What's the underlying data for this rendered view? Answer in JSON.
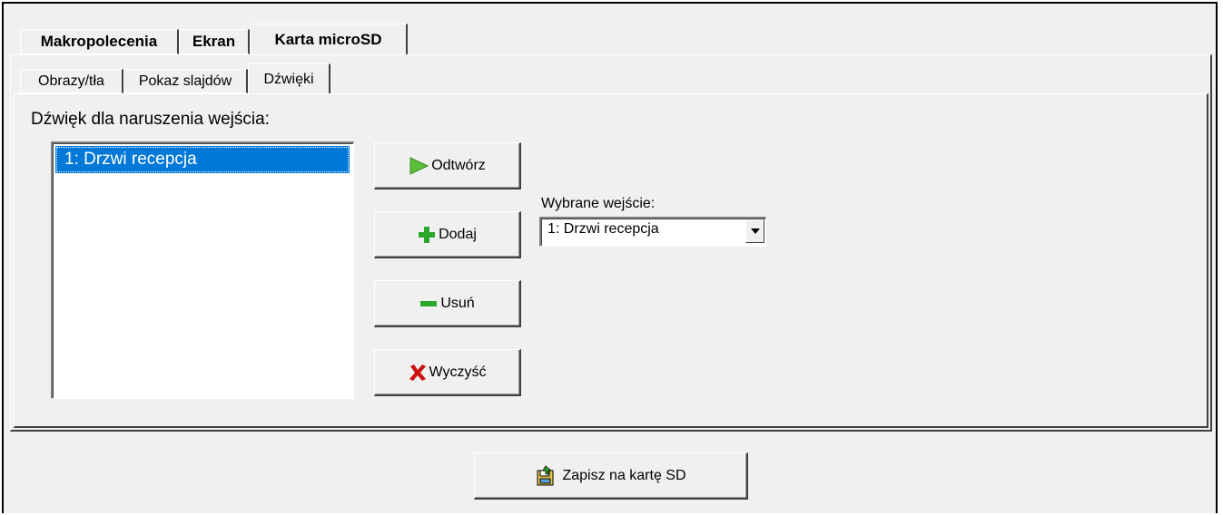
{
  "tabs": {
    "top": [
      {
        "label": "Makropolecenia"
      },
      {
        "label": "Ekran"
      },
      {
        "label": "Karta microSD"
      }
    ],
    "sub": [
      {
        "label": "Obrazy/tła"
      },
      {
        "label": "Pokaz slajdów"
      },
      {
        "label": "Dźwięki"
      }
    ],
    "active_top": "Karta microSD",
    "active_sub": "Dźwięki"
  },
  "sounds": {
    "list_label": "Dźwięk dla naruszenia wejścia:",
    "items": [
      "1: Drzwi recepcja"
    ],
    "selected_item": "1: Drzwi recepcja",
    "buttons": {
      "play": "Odtwórz",
      "add": "Dodaj",
      "remove": "Usuń",
      "clear": "Wyczyść"
    },
    "input_select": {
      "label": "Wybrane wejście:",
      "value": "1: Drzwi recepcja"
    }
  },
  "footer": {
    "save_label": "Zapisz na kartę SD"
  },
  "icons": {
    "play": "play-icon",
    "add": "plus-icon",
    "remove": "minus-icon",
    "clear": "x-icon",
    "save": "sd-card-save-icon",
    "dropdown": "chevron-down-icon"
  },
  "colors": {
    "selection": "#0078d7",
    "play_green": "#5bbf3a",
    "add_green": "#2aa82a",
    "clear_red": "#cc1111",
    "face": "#f0f0f0"
  }
}
